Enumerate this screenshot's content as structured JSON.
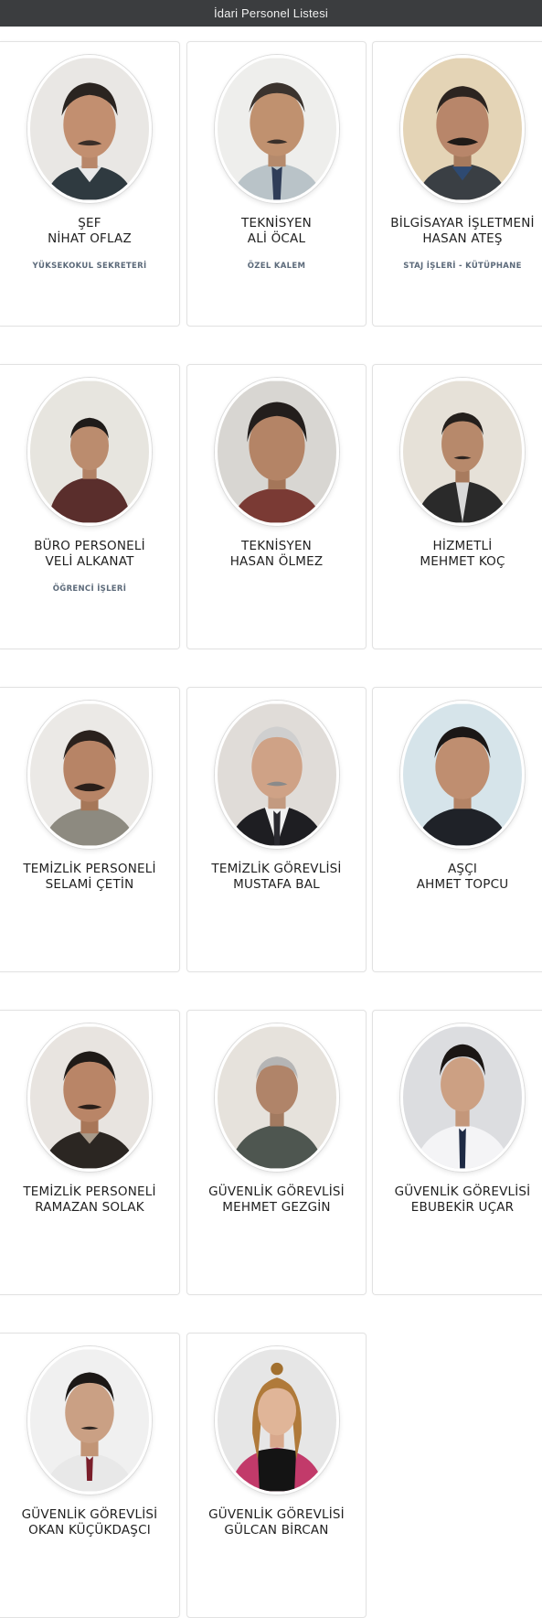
{
  "header": {
    "title": "İdari Personel Listesi"
  },
  "colors": {
    "header_bg": "#3b3d3f",
    "header_text": "#f0f0f0",
    "card_border": "#e2e2e2",
    "dept_text": "#5c6a7a"
  },
  "staff": [
    {
      "title": "ŞEF",
      "name": "NİHAT OFLAZ",
      "dept": "YÜKSEKOKUL SEKRETERİ"
    },
    {
      "title": "TEKNİSYEN",
      "name": "ALİ ÖCAL",
      "dept": "ÖZEL KALEM"
    },
    {
      "title": "BİLGİSAYAR İŞLETMENİ",
      "name": "HASAN ATEŞ",
      "dept": "STAJ İŞLERİ - KÜTÜPHANE"
    },
    {
      "title": "BÜRO PERSONELİ",
      "name": "VELİ ALKANAT",
      "dept": "ÖĞRENCİ İŞLERİ"
    },
    {
      "title": "TEKNİSYEN",
      "name": "HASAN ÖLMEZ",
      "dept": ""
    },
    {
      "title": "HİZMETLİ",
      "name": "MEHMET KOÇ",
      "dept": ""
    },
    {
      "title": "TEMİZLİK PERSONELİ",
      "name": "SELAMİ ÇETİN",
      "dept": ""
    },
    {
      "title": "TEMİZLİK GÖREVLİSİ",
      "name": "MUSTAFA BAL",
      "dept": ""
    },
    {
      "title": "AŞÇI",
      "name": "AHMET TOPCU",
      "dept": ""
    },
    {
      "title": "TEMİZLİK PERSONELİ",
      "name": "RAMAZAN SOLAK",
      "dept": ""
    },
    {
      "title": "GÜVENLİK GÖREVLİSİ",
      "name": "MEHMET GEZGİN",
      "dept": ""
    },
    {
      "title": "GÜVENLİK GÖREVLİSİ",
      "name": "EBUBEKİR UÇAR",
      "dept": ""
    },
    {
      "title": "GÜVENLİK GÖREVLİSİ",
      "name": "OKAN KÜÇÜKDAŞCI",
      "dept": ""
    },
    {
      "title": "GÜVENLİK GÖREVLİSİ",
      "name": "GÜLCAN BİRCAN",
      "dept": ""
    }
  ]
}
